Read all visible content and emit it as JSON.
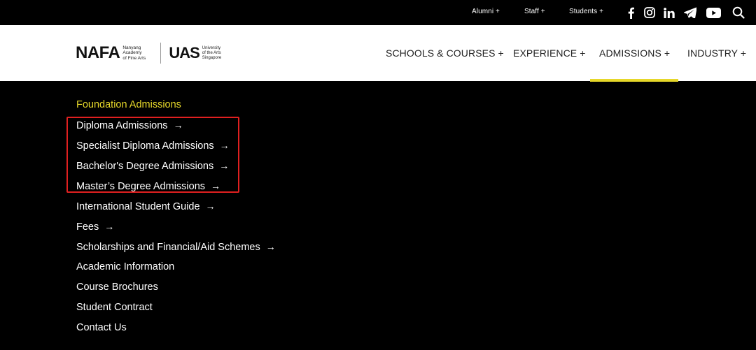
{
  "topbar": {
    "links": [
      {
        "label": "Alumni +"
      },
      {
        "label": "Staff +"
      },
      {
        "label": "Students +"
      }
    ],
    "social_icons": [
      "facebook-icon",
      "instagram-icon",
      "linkedin-icon",
      "telegram-icon",
      "youtube-icon",
      "search-icon"
    ]
  },
  "logo": {
    "nafa_word": "NAFA",
    "nafa_sub_1": "Nanyang",
    "nafa_sub_2": "Academy",
    "nafa_sub_3": "of Fine Arts",
    "uas_word": "UAS",
    "uas_sub_1": "University",
    "uas_sub_2": "of the Arts",
    "uas_sub_3": "Singapore"
  },
  "nav": {
    "items": [
      {
        "label": "SCHOOLS & COURSES +"
      },
      {
        "label": "EXPERIENCE +"
      },
      {
        "label": "ADMISSIONS +"
      },
      {
        "label": "INDUSTRY +"
      }
    ],
    "active_index": 2,
    "accent_color": "#e6d72a"
  },
  "menu": {
    "items": [
      {
        "label": "Foundation Admissions",
        "arrow": ""
      },
      {
        "label": "Diploma Admissions",
        "arrow": "→"
      },
      {
        "label": "Specialist Diploma Admissions",
        "arrow": "→"
      },
      {
        "label": "Bachelor's Degree Admissions",
        "arrow": "→"
      },
      {
        "label": "Master’s Degree Admissions",
        "arrow": "→"
      },
      {
        "label": "International Student Guide",
        "arrow": "→"
      },
      {
        "label": "Fees",
        "arrow": "→"
      },
      {
        "label": "Scholarships and Financial/Aid Schemes",
        "arrow": "→"
      },
      {
        "label": "Academic Information",
        "arrow": ""
      },
      {
        "label": "Course Brochures",
        "arrow": ""
      },
      {
        "label": "Student Contract",
        "arrow": ""
      },
      {
        "label": "Contact Us",
        "arrow": ""
      }
    ],
    "highlight_color": "#e02020"
  }
}
